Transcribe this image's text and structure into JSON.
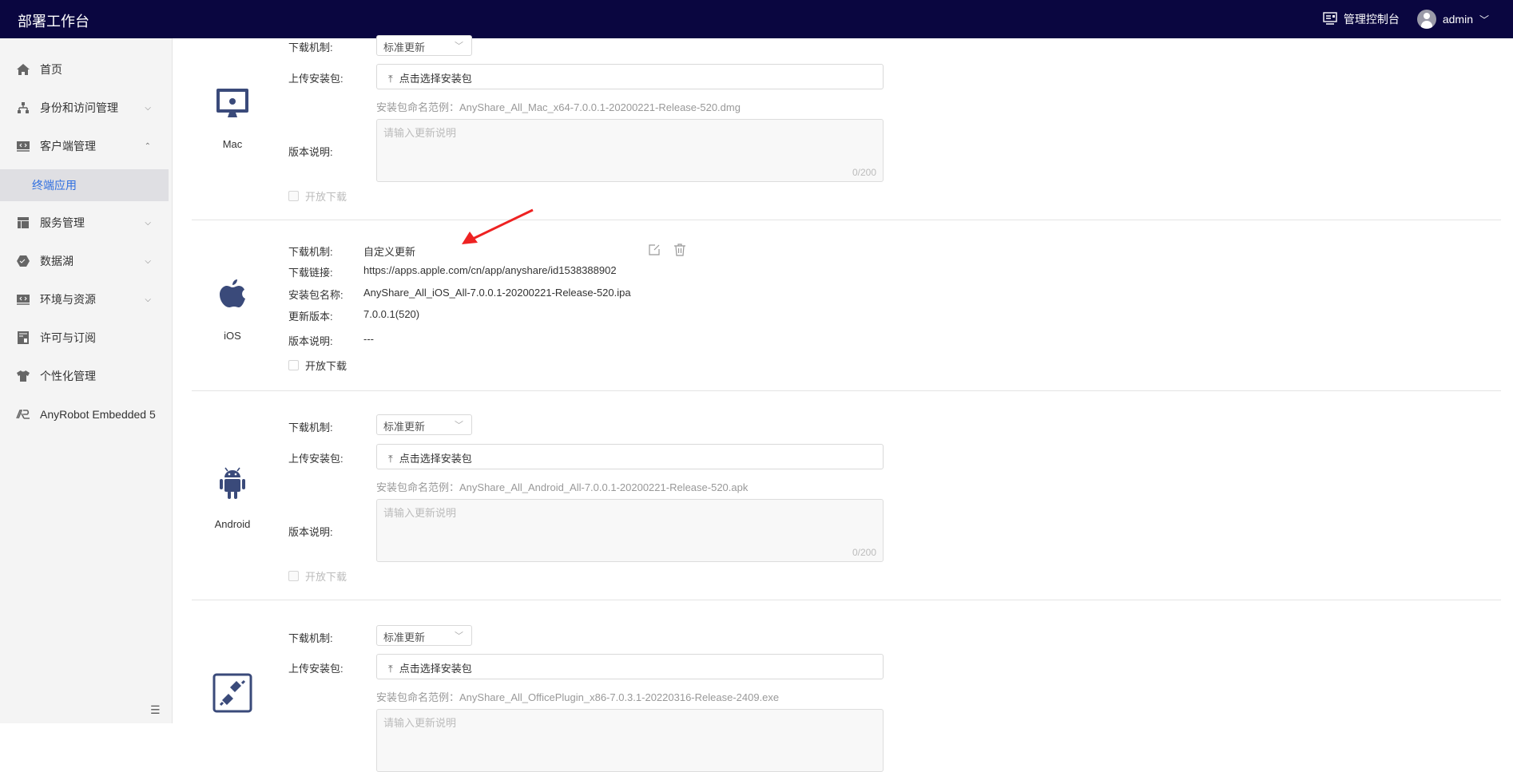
{
  "header": {
    "title": "部署工作台",
    "console_label": "管理控制台",
    "user": "admin"
  },
  "sidebar": {
    "items": [
      {
        "label": "首页",
        "icon": "home-icon"
      },
      {
        "label": "身份和访问管理",
        "icon": "org-icon",
        "expandable": true
      },
      {
        "label": "客户端管理",
        "icon": "code-icon",
        "expanded": true
      },
      {
        "label": "终端应用",
        "sub": true,
        "active": true
      },
      {
        "label": "服务管理",
        "icon": "layout-icon",
        "expandable": true
      },
      {
        "label": "数据湖",
        "icon": "datalake-icon",
        "expandable": true
      },
      {
        "label": "环境与资源",
        "icon": "code-icon",
        "expandable": true
      },
      {
        "label": "许可与订阅",
        "icon": "license-icon"
      },
      {
        "label": "个性化管理",
        "icon": "shirt-icon"
      },
      {
        "label": "AnyRobot Embedded 5",
        "icon": "anyrobot-icon"
      }
    ]
  },
  "labels": {
    "mechanism": "下载机制:",
    "upload": "上传安装包:",
    "notes": "版本说明:",
    "link": "下载链接:",
    "pkg_name": "安装包名称:",
    "version": "更新版本:",
    "open_download": "开放下载",
    "upload_btn": "点击选择安装包",
    "notes_placeholder": "请输入更新说明",
    "counter": "0/200"
  },
  "platforms": {
    "mac": {
      "name": "Mac",
      "mechanism": "标准更新",
      "hint": "安装包命名范例：AnyShare_All_Mac_x64-7.0.0.1-20200221-Release-520.dmg"
    },
    "ios": {
      "name": "iOS",
      "mechanism": "自定义更新",
      "link": "https://apps.apple.com/cn/app/anyshare/id1538388902",
      "pkg_name": "AnyShare_All_iOS_All-7.0.0.1-20200221-Release-520.ipa",
      "version": "7.0.0.1(520)",
      "notes": "---"
    },
    "android": {
      "name": "Android",
      "mechanism": "标准更新",
      "hint": "安装包命名范例：AnyShare_All_Android_All-7.0.0.1-20200221-Release-520.apk"
    },
    "office": {
      "mechanism": "标准更新",
      "hint": "安装包命名范例：AnyShare_All_OfficePlugin_x86-7.0.3.1-20220316-Release-2409.exe"
    }
  },
  "colors": {
    "header": "#0a0640",
    "accent": "#2f6fe0",
    "icon": "#3a4a7a",
    "annotation_arrow": "#ee2222"
  }
}
